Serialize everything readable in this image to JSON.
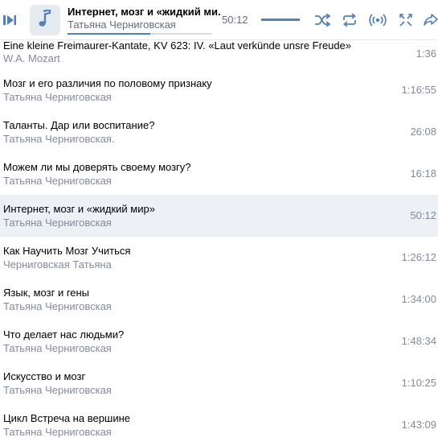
{
  "colors": {
    "accent": "#5181b8",
    "secondary_text": "#828a99",
    "active_row": "#edf0f5"
  },
  "player": {
    "title": "Интернет, мозг и «жидкий ми...",
    "artist": "Татьяна Черниговская",
    "time": "50:12",
    "progress_fraction": 0.57,
    "volume_fraction": 1.0,
    "icons": [
      "prev-icon",
      "next-icon",
      "music-note-icon",
      "shuffle-icon",
      "repeat-icon",
      "broadcast-icon",
      "related-icon",
      "share-icon"
    ]
  },
  "tracks": [
    {
      "title": "Eine kleine Freimaurer-Kantate, KV 623: IV. «Laut verkünde unsre Freude»",
      "artist": "W.A. Mozart",
      "duration": "1:36"
    },
    {
      "title": "Мозг и его различия по половому признаку",
      "artist": "Татьяна Черниговская",
      "duration": "1:16:55"
    },
    {
      "title": "Таланты. Дар или воспитание?",
      "artist": "Татьяна Черниговская.",
      "duration": "26:08"
    },
    {
      "title": "Можем ли мы доверять своему мозгу?",
      "artist": "Татьяна Черниговская",
      "duration": "16:18"
    },
    {
      "title": "Интернет, мозг и «жидкий мир»",
      "artist": "Татьяна Черниговская",
      "duration": "50:12",
      "active": true
    },
    {
      "title": "Как Научить Мозг Учиться",
      "artist": "Черниговская Татьяна",
      "duration": "1:26:12"
    },
    {
      "title": "Язык, мозг и гены",
      "artist": "Татьяна Черниговская",
      "duration": "1:34:00"
    },
    {
      "title": "Что делает нас людьми?",
      "artist": "Татьяна Черниговская",
      "duration": "1:48:34"
    },
    {
      "title": "Искусство и мозг",
      "artist": "Татьяна Черниговская",
      "duration": "1:10:25"
    },
    {
      "title": "Цикл Встреча на вершине",
      "artist": "Татьяна Черниговская",
      "duration": "1:43:09"
    }
  ]
}
